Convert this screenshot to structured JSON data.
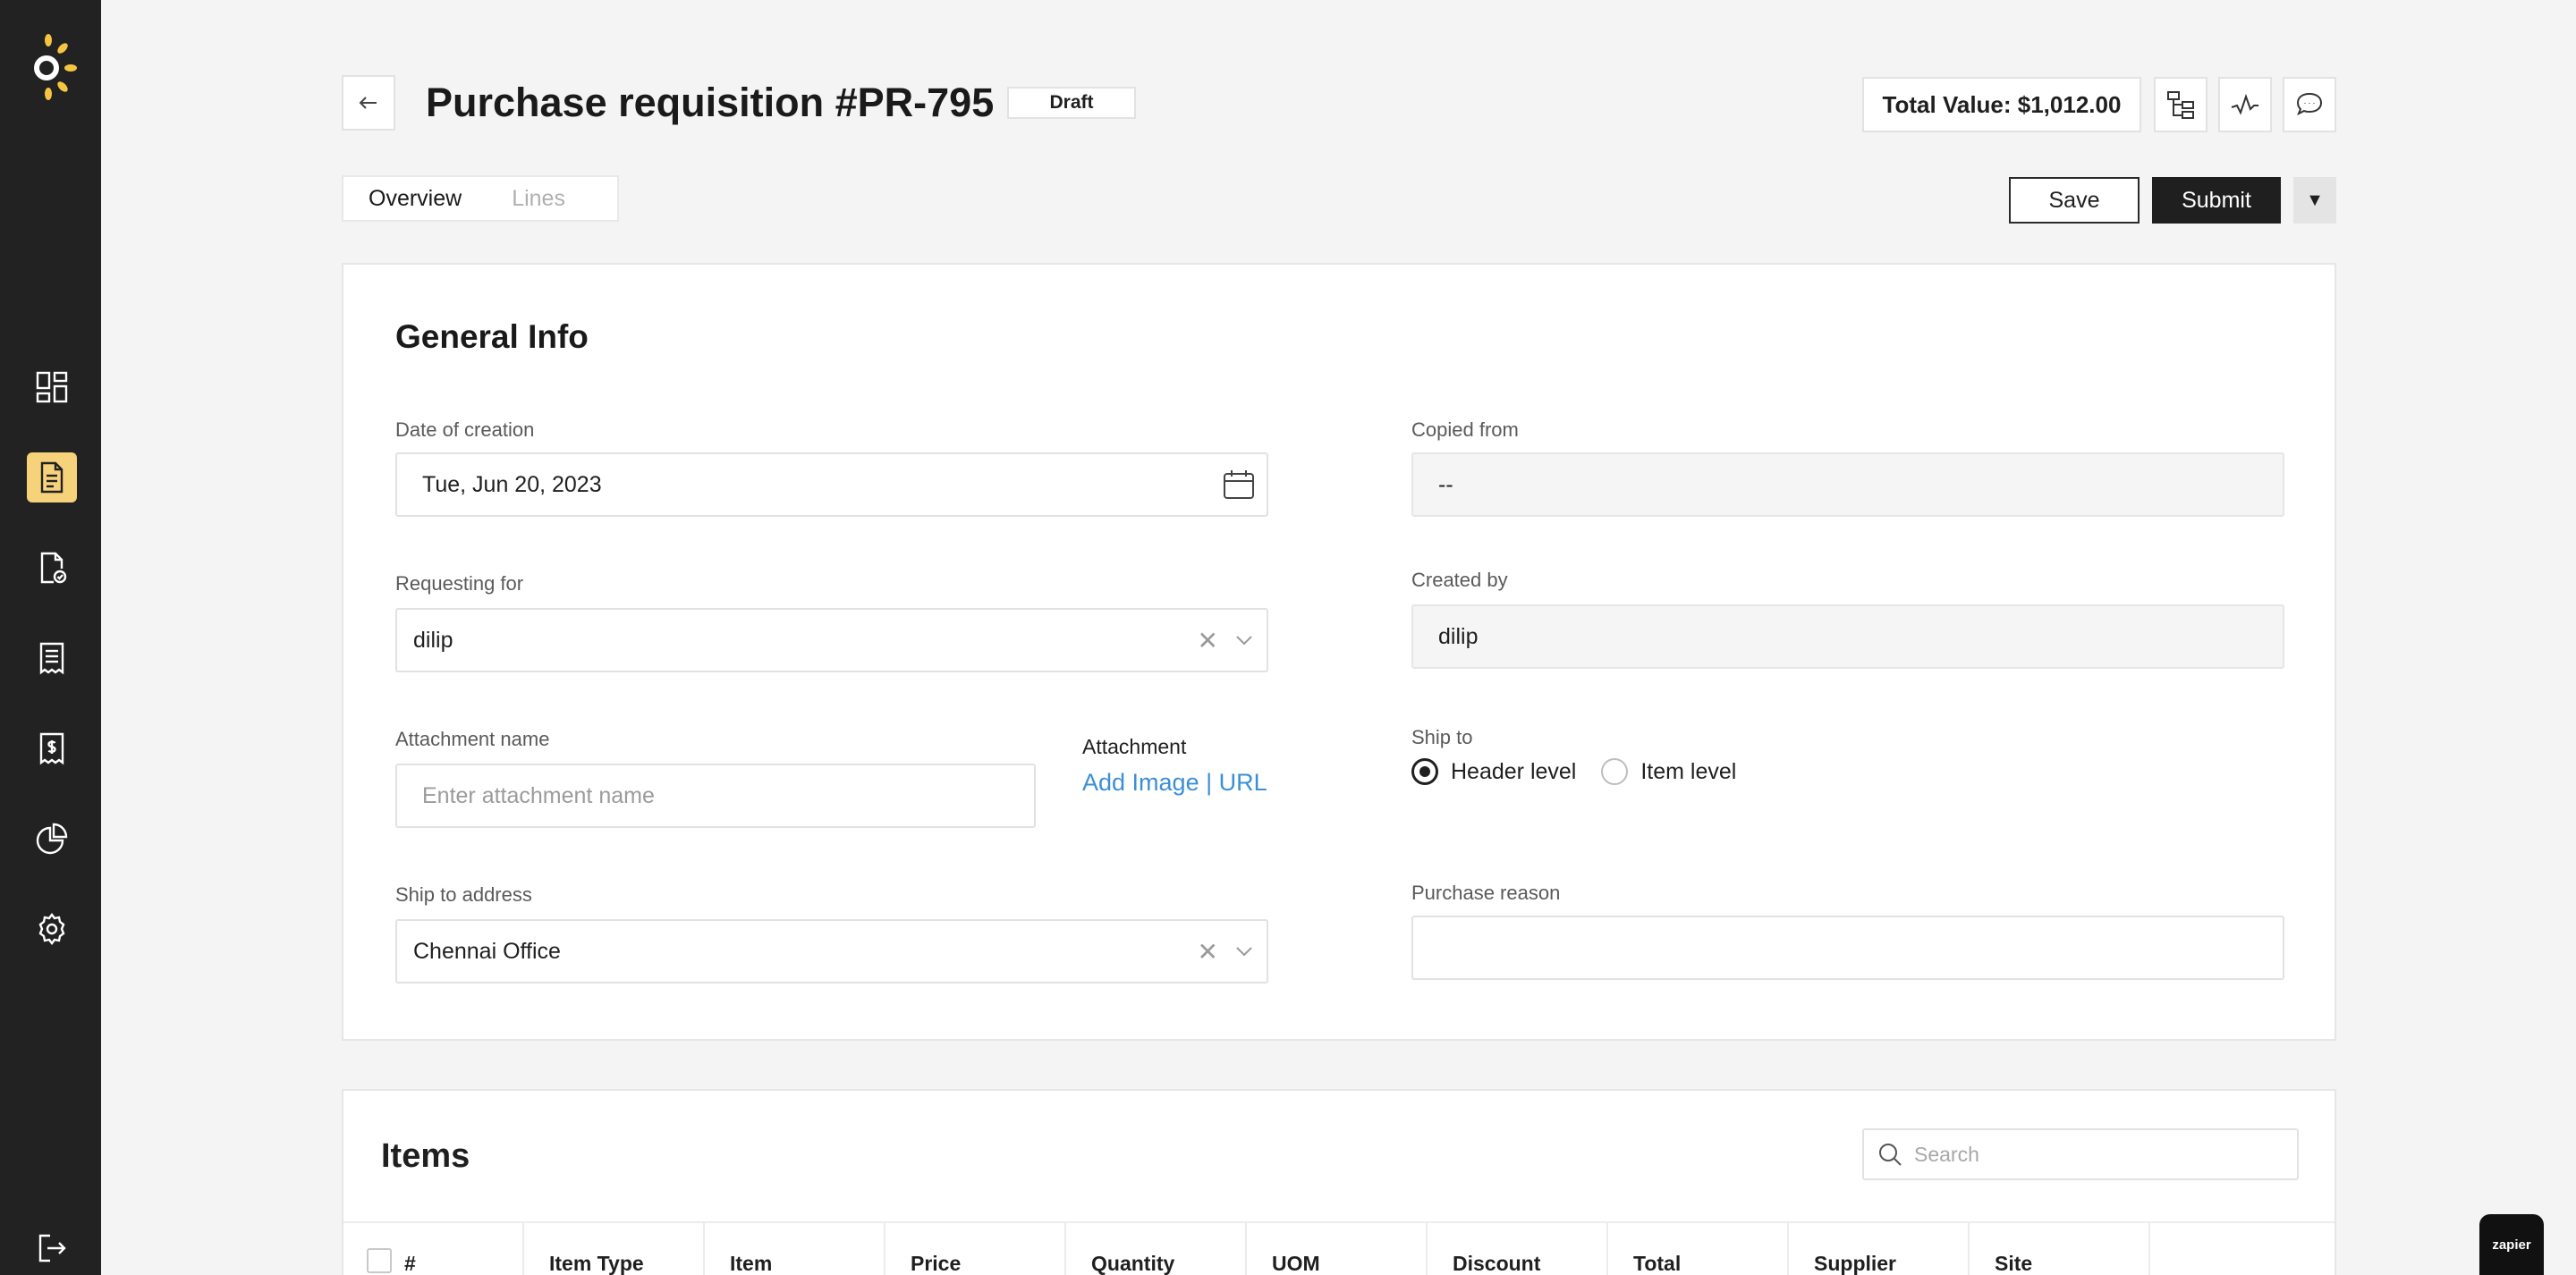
{
  "sidebar": {
    "items": [
      {
        "icon": "dashboard-icon",
        "active": false
      },
      {
        "icon": "document-icon",
        "active": true
      },
      {
        "icon": "approval-document-icon",
        "active": false
      },
      {
        "icon": "receipt-icon",
        "active": false
      },
      {
        "icon": "invoice-icon",
        "active": false
      },
      {
        "icon": "pie-chart-icon",
        "active": false
      },
      {
        "icon": "gear-icon",
        "active": false
      },
      {
        "icon": "logout-icon",
        "active": false
      }
    ]
  },
  "header": {
    "title": "Purchase requisition #PR-795",
    "status": "Draft",
    "total_value": "Total Value: $1,012.00"
  },
  "tabs": [
    {
      "label": "Overview",
      "active": true
    },
    {
      "label": "Lines",
      "active": false
    }
  ],
  "actions": {
    "save": "Save",
    "submit": "Submit"
  },
  "general_info": {
    "title": "General Info",
    "date_of_creation": {
      "label": "Date of creation",
      "value": "Tue, Jun 20, 2023"
    },
    "copied_from": {
      "label": "Copied from",
      "value": "--"
    },
    "requesting_for": {
      "label": "Requesting for",
      "value": "dilip"
    },
    "created_by": {
      "label": "Created by",
      "value": "dilip"
    },
    "attachment_name": {
      "label": "Attachment name",
      "placeholder": "Enter attachment name"
    },
    "attachment": {
      "label": "Attachment",
      "link": "Add Image | URL"
    },
    "ship_to": {
      "label": "Ship to",
      "options": [
        "Header level",
        "Item level"
      ],
      "selected": "Header level"
    },
    "ship_to_address": {
      "label": "Ship to address",
      "value": "Chennai Office"
    },
    "purchase_reason": {
      "label": "Purchase reason",
      "value": ""
    }
  },
  "items": {
    "title": "Items",
    "search_placeholder": "Search",
    "columns": [
      "#",
      "Item Type",
      "Item",
      "Price",
      "Quantity",
      "UOM",
      "Discount",
      "Total",
      "Supplier",
      "Site"
    ]
  },
  "zapier_label": "zapier"
}
